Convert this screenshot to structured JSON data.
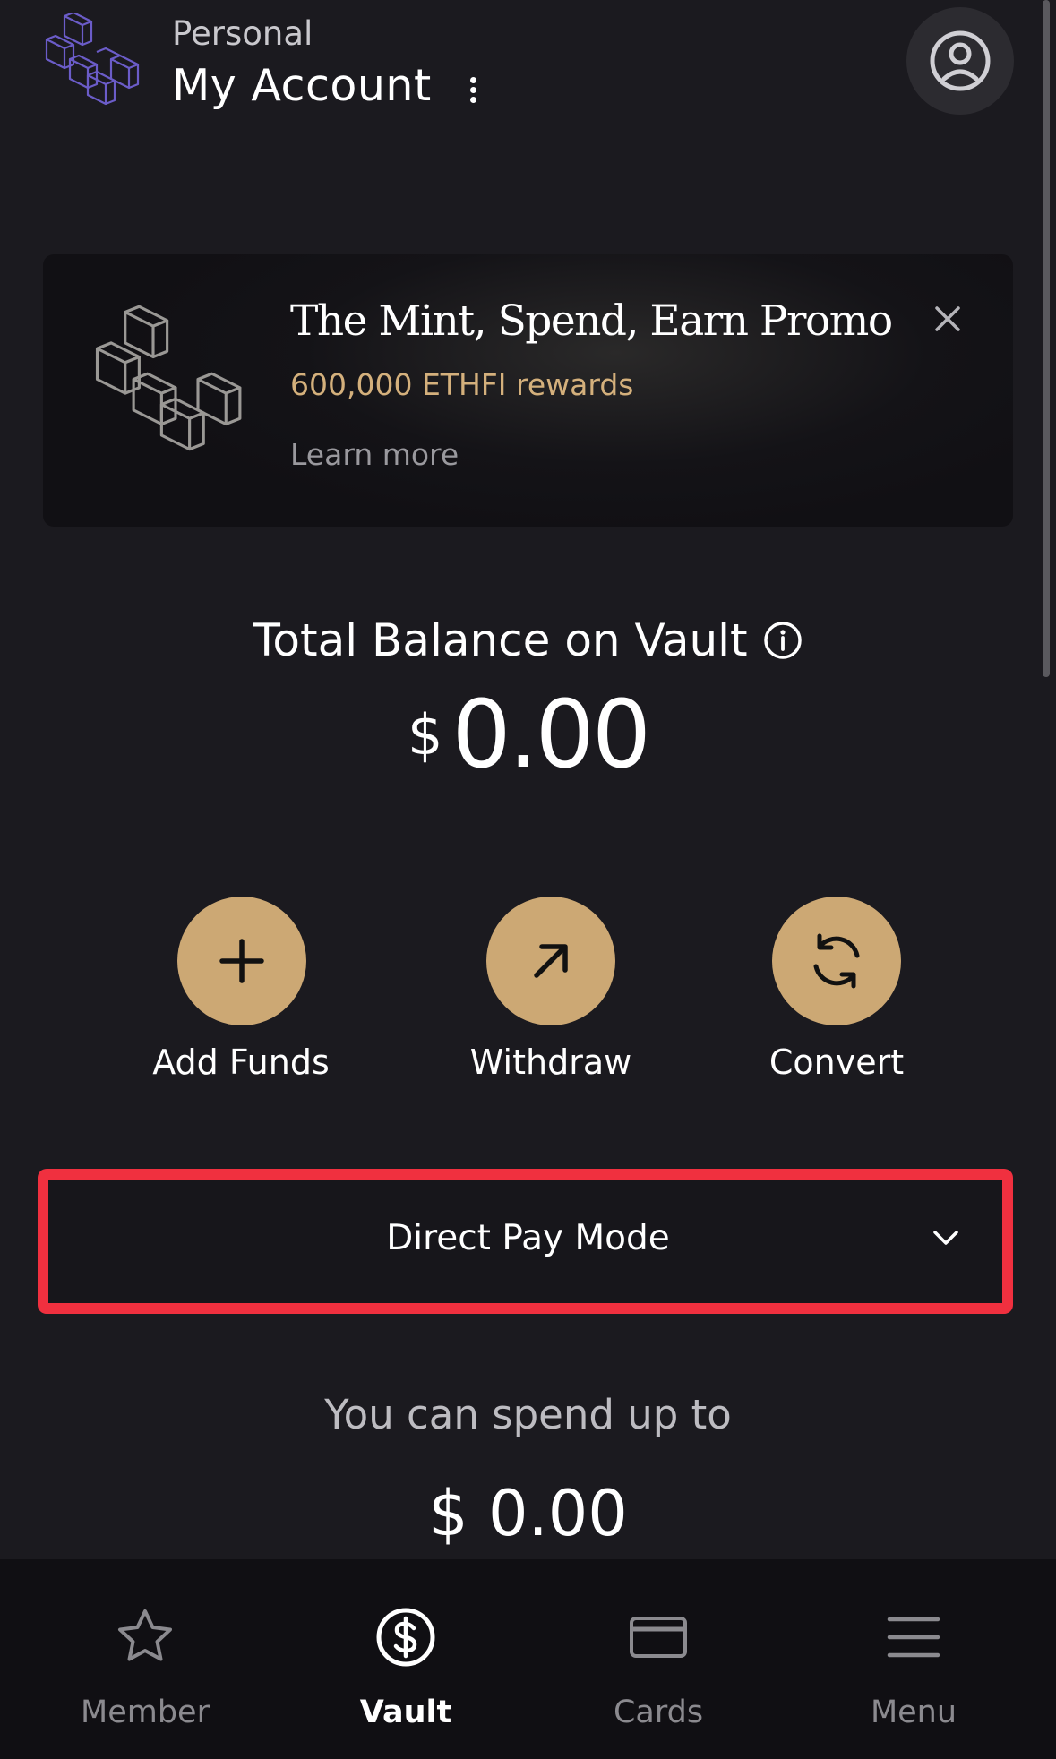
{
  "header": {
    "account_type": "Personal",
    "account_name": "My Account"
  },
  "promo": {
    "title": "The Mint, Spend, Earn Promo",
    "subtitle": "600,000 ETHFI rewards",
    "link": "Learn more"
  },
  "balance": {
    "label": "Total Balance on Vault",
    "currency": "$",
    "amount": "0.00"
  },
  "actions": [
    {
      "label": "Add Funds",
      "icon": "plus-icon"
    },
    {
      "label": "Withdraw",
      "icon": "arrow-up-right-icon"
    },
    {
      "label": "Convert",
      "icon": "refresh-icon"
    }
  ],
  "mode_select": {
    "value": "Direct Pay Mode"
  },
  "spend": {
    "label": "You can spend up to",
    "amount": "$ 0.00"
  },
  "nav": [
    {
      "label": "Member",
      "icon": "star-icon",
      "active": false
    },
    {
      "label": "Vault",
      "icon": "dollar-circle-icon",
      "active": true
    },
    {
      "label": "Cards",
      "icon": "card-icon",
      "active": false
    },
    {
      "label": "Menu",
      "icon": "menu-icon",
      "active": false
    }
  ],
  "colors": {
    "background": "#1b1a1f",
    "accent": "#cca874",
    "highlight": "#f0303f",
    "brand_purple": "#6b5cc8"
  }
}
